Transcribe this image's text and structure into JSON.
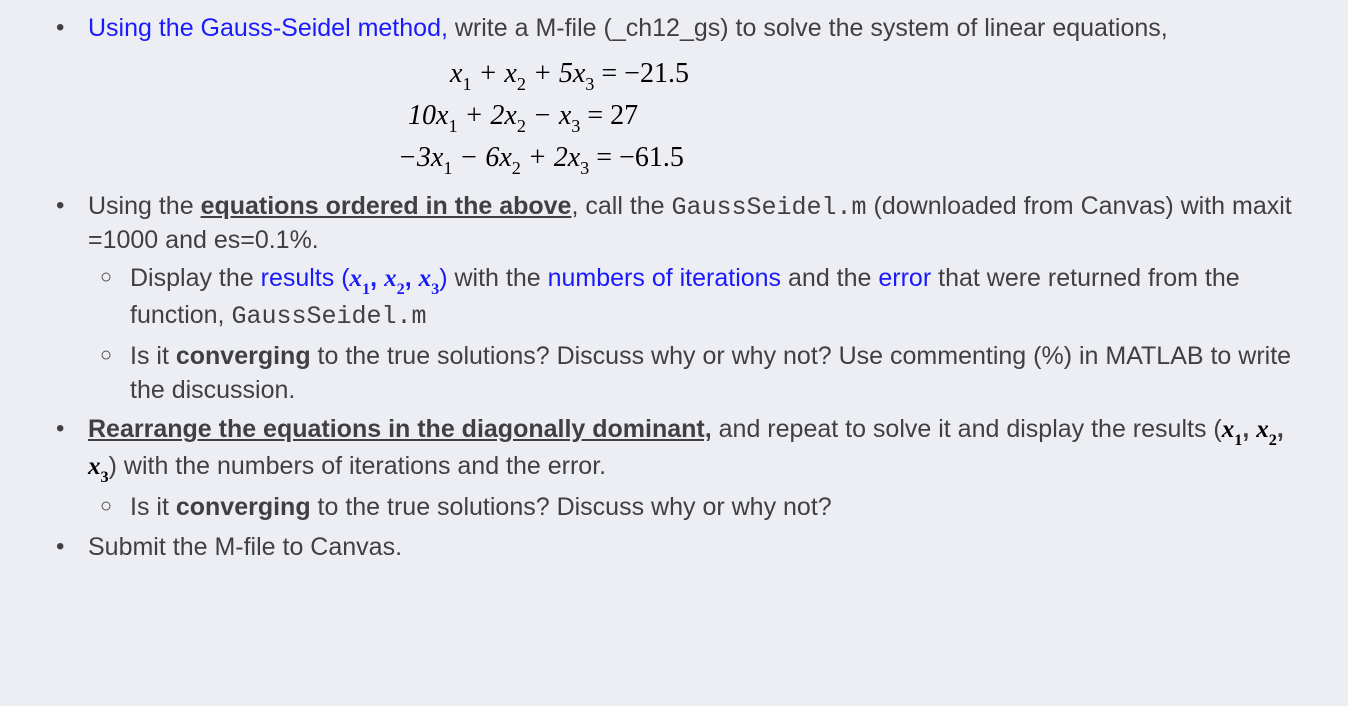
{
  "b1": {
    "blue": "Using the Gauss-Seidel method,",
    "rest": " write a M-file (_ch12_gs) to solve the system of linear equations,"
  },
  "eq": {
    "l1_a": "x",
    "l1_b": "1",
    "l1_c": " +   x",
    "l1_d": "2",
    "l1_e": " + 5x",
    "l1_f": "3",
    "l1_g": " = −21.5",
    "l2_a": "10x",
    "l2_b": "1",
    "l2_c": " + 2x",
    "l2_d": "2",
    "l2_e": "  − x",
    "l2_f": "3",
    "l2_g": " = 27",
    "l3_a": "−3x",
    "l3_b": "1",
    "l3_c": " − 6x",
    "l3_d": "2",
    "l3_e": " + 2x",
    "l3_f": "3",
    "l3_g": " = −61.5"
  },
  "b2": {
    "pre": "Using the ",
    "u": "equations ordered in the above",
    "mid": ", call the ",
    "code": "GaussSeidel.m",
    "post": " (downloaded from Canvas) with maxit =1000 and es=0.1%."
  },
  "b2s1": {
    "a": "Display the ",
    "b": "results (",
    "c": "x",
    "c1": "1",
    "d": ", ",
    "e": "x",
    "e1": "2",
    "f": ", ",
    "g": "x",
    "g1": "3",
    "h": ")",
    "i": " with the ",
    "j": "numbers of iterations",
    "k": " and the ",
    "l": "error",
    "m": " that were returned from the function, ",
    "n": "GaussSeidel.m"
  },
  "b2s2": {
    "a": "Is it ",
    "b": "converging",
    "c": " to the true solutions? Discuss why or why not? Use commenting (%) in MATLAB to write the discussion."
  },
  "b3": {
    "u": "Rearrange the equations in the diagonally dominant,",
    "mid": " and repeat to solve it and display the results (",
    "x1a": "x",
    "x1b": "1",
    "sep1": ", ",
    "x2a": "x",
    "x2b": "2",
    "sep2": ", ",
    "x3a": "x",
    "x3b": "3",
    "post": ") with the numbers of iterations and the error."
  },
  "b3s1": {
    "a": "Is it ",
    "b": "converging",
    "c": " to the true solutions? Discuss why or why not?"
  },
  "b4": "Submit the M-file to Canvas."
}
